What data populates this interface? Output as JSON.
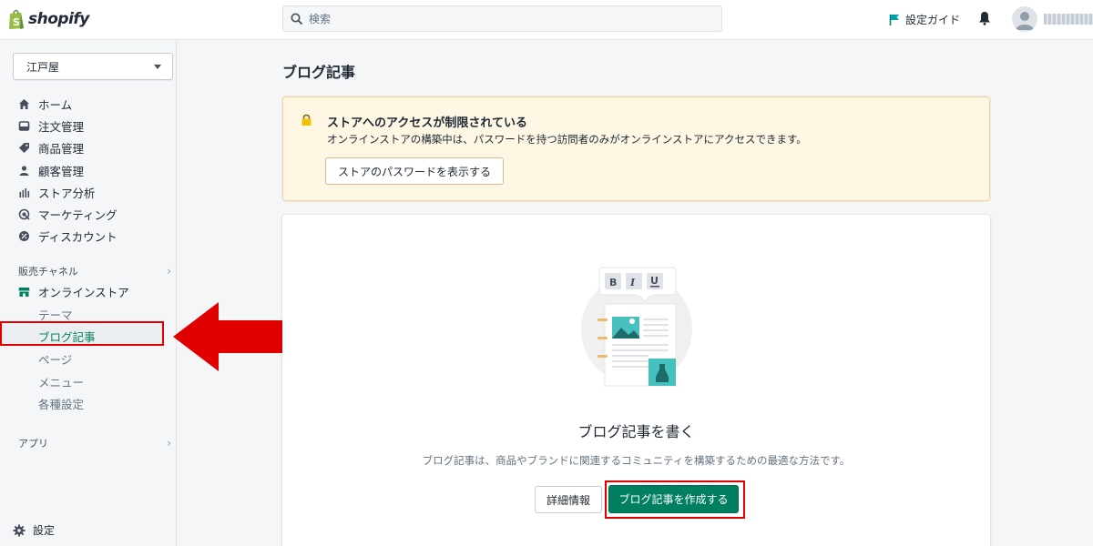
{
  "topbar": {
    "logo_text": "shopify",
    "search_placeholder": "検索",
    "setup_guide": "設定ガイド"
  },
  "sidebar": {
    "store_name": "江戸屋",
    "items": [
      {
        "label": "ホーム",
        "icon": "home-icon"
      },
      {
        "label": "注文管理",
        "icon": "orders-icon"
      },
      {
        "label": "商品管理",
        "icon": "tag-icon"
      },
      {
        "label": "顧客管理",
        "icon": "customer-icon"
      },
      {
        "label": "ストア分析",
        "icon": "analytics-icon"
      },
      {
        "label": "マーケティング",
        "icon": "marketing-icon"
      },
      {
        "label": "ディスカウント",
        "icon": "discount-icon"
      }
    ],
    "sales_channels_label": "販売チャネル",
    "online_store_label": "オンラインストア",
    "sub_items": [
      "テーマ",
      "ブログ記事",
      "ページ",
      "メニュー",
      "各種設定"
    ],
    "apps_label": "アプリ",
    "settings_label": "設定"
  },
  "main": {
    "page_title": "ブログ記事",
    "banner": {
      "title": "ストアへのアクセスが制限されている",
      "text": "オンラインストアの構築中は、パスワードを持つ訪問者のみがオンラインストアにアクセスできます。",
      "button": "ストアのパスワードを表示する"
    },
    "empty_state": {
      "title": "ブログ記事を書く",
      "description": "ブログ記事は、商品やブランドに関連するコミュニティを構築するための最適な方法です。",
      "info_button": "詳細情報",
      "create_button": "ブログ記事を作成する"
    }
  },
  "colors": {
    "brand_green": "#008060",
    "highlight_red": "#e00000",
    "banner_bg": "#fdf7e3"
  }
}
